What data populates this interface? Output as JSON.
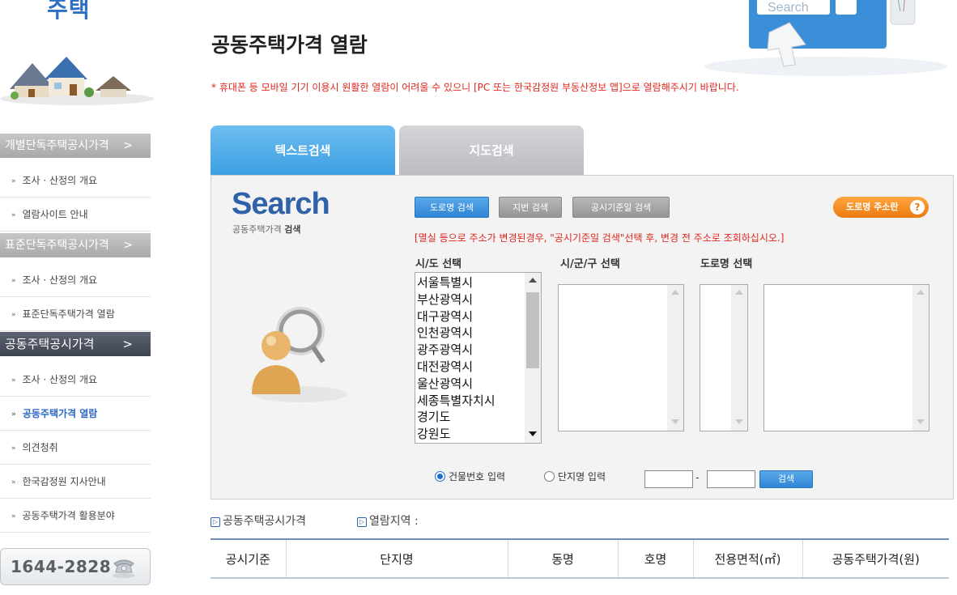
{
  "sidebar": {
    "brand_fragment": "주택",
    "sections": [
      {
        "title": "개별단독주택공시가격",
        "arrow": ">"
      },
      {
        "title": "표준단독주택공시가격",
        "arrow": ">"
      },
      {
        "title": "공동주택공시가격",
        "arrow": ">"
      }
    ],
    "items": [
      "조사 · 산정의 개요",
      "열람사이트 안내",
      "조사 · 산정의 개요",
      "표준단독주택가격 열람",
      "조사 · 산정의 개요",
      "공동주택가격 열람",
      "의견청취",
      "한국감정원 지사안내",
      "공동주택가격 활용분야"
    ],
    "bullet": "»",
    "phone": "1644-2828"
  },
  "page": {
    "title": "공동주택가격 열람",
    "hero_text": "Search",
    "notice": "* 휴대폰 등 모바일 기기 이용시 원활한 열람이 어려울 수 있으니 [PC 또는 한국감정원 부동산정보 앱]으로 열람해주시기 바랍니다."
  },
  "tabs": [
    {
      "label": "텍스트검색",
      "active": true
    },
    {
      "label": "지도검색",
      "active": false
    }
  ],
  "search": {
    "logo": "Search",
    "subtitle_plain": "공동주택가격 ",
    "subtitle_bold": "검색",
    "buttons": {
      "road": "도로명 검색",
      "jibun": "지번 검색",
      "date": "공시기준일 검색",
      "road_info": "도로명 주소란",
      "help": "?"
    },
    "change_notice": "[멸실 등으로 주소가 변경된경우, \"공시기준일 검색\"선택 후, 변경 전 주소로 조회하십시오.]",
    "labels": {
      "sido": "시/도 선택",
      "sigungu": "시/군/구 선택",
      "road": "도로명 선택"
    },
    "sido_options": [
      "서울특별시",
      "부산광역시",
      "대구광역시",
      "인천광역시",
      "광주광역시",
      "대전광역시",
      "울산광역시",
      "세종특별자치시",
      "경기도",
      "강원도"
    ],
    "radio_building": "건물번호 입력",
    "radio_complex": "단지명 입력",
    "dash": "-",
    "search_button": "검색"
  },
  "info": {
    "price_label": "공동주택공시가격",
    "region_label": "열람지역 :",
    "icon": "▷"
  },
  "table": {
    "headers": [
      "공시기준",
      "단지명",
      "동명",
      "호명",
      "전용면적(㎡)",
      "공동주택가격(원)"
    ]
  },
  "colors": {
    "accent_blue": "#3d9fe2",
    "notice_red": "#e0261e",
    "sidebar_dark": "#3e4350",
    "orange": "#ea7a10"
  }
}
